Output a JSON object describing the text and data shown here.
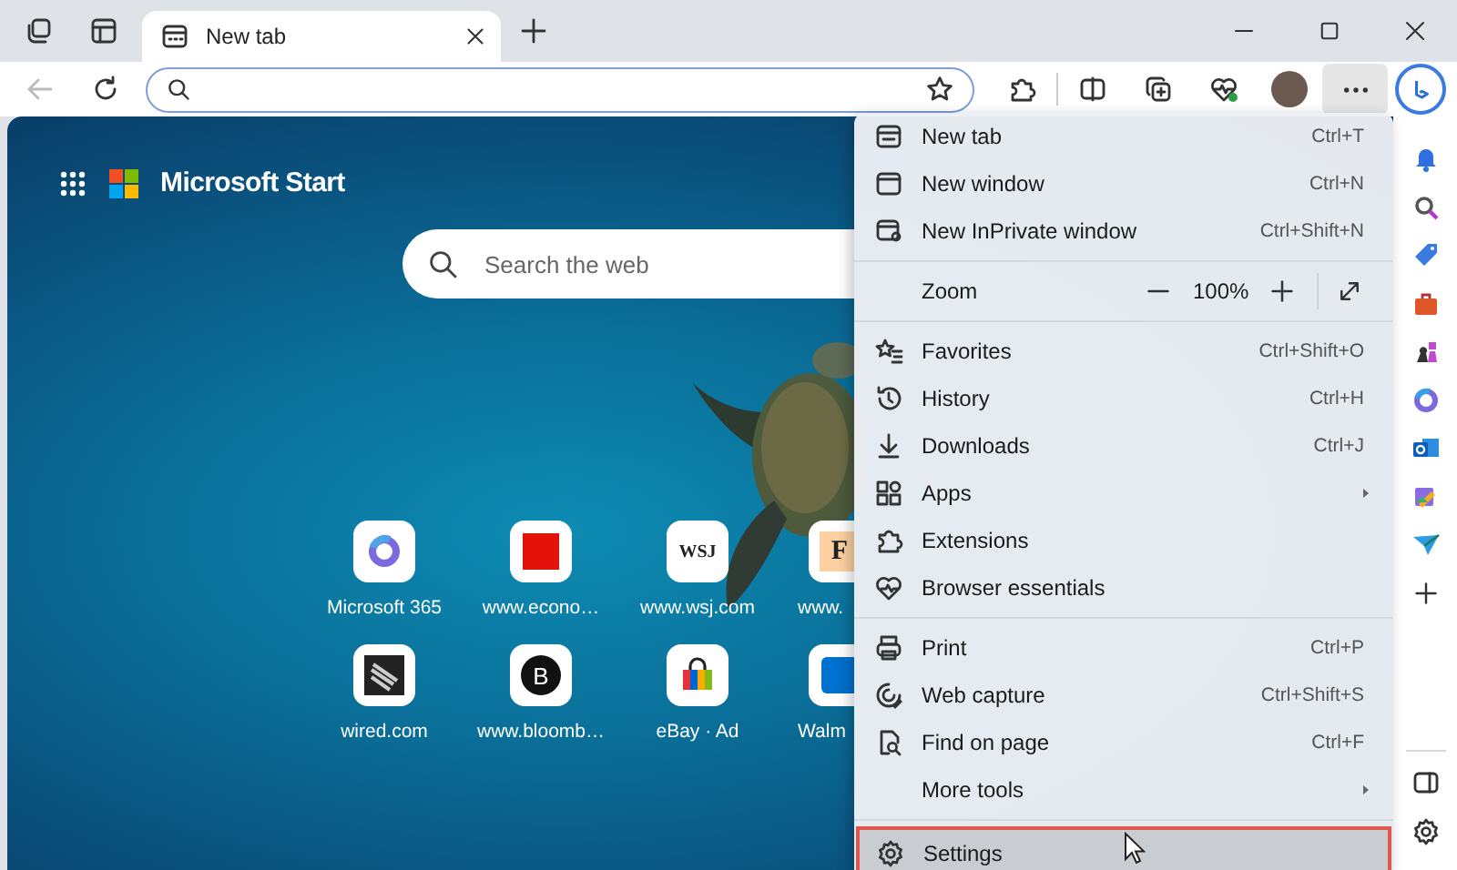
{
  "window": {
    "tab_title": "New tab"
  },
  "start_page": {
    "brand": "Microsoft Start",
    "search_placeholder": "Search the web",
    "tiles": [
      {
        "kind": "m365",
        "label": "Microsoft 365"
      },
      {
        "kind": "economist",
        "label": "www.econo…"
      },
      {
        "kind": "wsj",
        "label": "www.wsj.com",
        "icon_text": "WSJ"
      },
      {
        "kind": "ft",
        "label": "www.",
        "icon_text": "F"
      },
      {
        "kind": "wired",
        "label": "wired.com"
      },
      {
        "kind": "bloomberg",
        "label": "www.bloomb…",
        "icon_text": "B"
      },
      {
        "kind": "ebay",
        "label": "eBay · Ad"
      },
      {
        "kind": "walmart",
        "label": "Walm"
      }
    ]
  },
  "menu": {
    "items": [
      {
        "kind": "item",
        "label": "New tab",
        "shortcut": "Ctrl+T",
        "submenu": false,
        "separator_before": false,
        "selected": false
      },
      {
        "kind": "item",
        "label": "New window",
        "shortcut": "Ctrl+N",
        "submenu": false,
        "separator_before": false,
        "selected": false
      },
      {
        "kind": "item",
        "label": "New InPrivate window",
        "shortcut": "Ctrl+Shift+N",
        "submenu": false,
        "separator_before": false,
        "selected": false
      },
      {
        "kind": "zoom",
        "label": "Zoom",
        "value": "100%",
        "separator_before": true,
        "selected": false
      },
      {
        "kind": "item",
        "label": "Favorites",
        "shortcut": "Ctrl+Shift+O",
        "submenu": false,
        "separator_before": true,
        "selected": false
      },
      {
        "kind": "item",
        "label": "History",
        "shortcut": "Ctrl+H",
        "submenu": false,
        "separator_before": false,
        "selected": false
      },
      {
        "kind": "item",
        "label": "Downloads",
        "shortcut": "Ctrl+J",
        "submenu": false,
        "separator_before": false,
        "selected": false
      },
      {
        "kind": "item",
        "label": "Apps",
        "submenu": true,
        "separator_before": false,
        "selected": false
      },
      {
        "kind": "item",
        "label": "Extensions",
        "submenu": false,
        "separator_before": false,
        "selected": false
      },
      {
        "kind": "item",
        "label": "Browser essentials",
        "submenu": false,
        "separator_before": false,
        "selected": false
      },
      {
        "kind": "item",
        "label": "Print",
        "shortcut": "Ctrl+P",
        "submenu": false,
        "separator_before": true,
        "selected": false
      },
      {
        "kind": "item",
        "label": "Web capture",
        "shortcut": "Ctrl+Shift+S",
        "submenu": false,
        "separator_before": false,
        "selected": false
      },
      {
        "kind": "item",
        "label": "Find on page",
        "shortcut": "Ctrl+F",
        "submenu": false,
        "separator_before": false,
        "selected": false
      },
      {
        "kind": "item",
        "label": "More tools",
        "submenu": true,
        "separator_before": false,
        "selected": false
      },
      {
        "kind": "item",
        "label": "Settings",
        "submenu": false,
        "separator_before": true,
        "selected": true
      }
    ]
  }
}
